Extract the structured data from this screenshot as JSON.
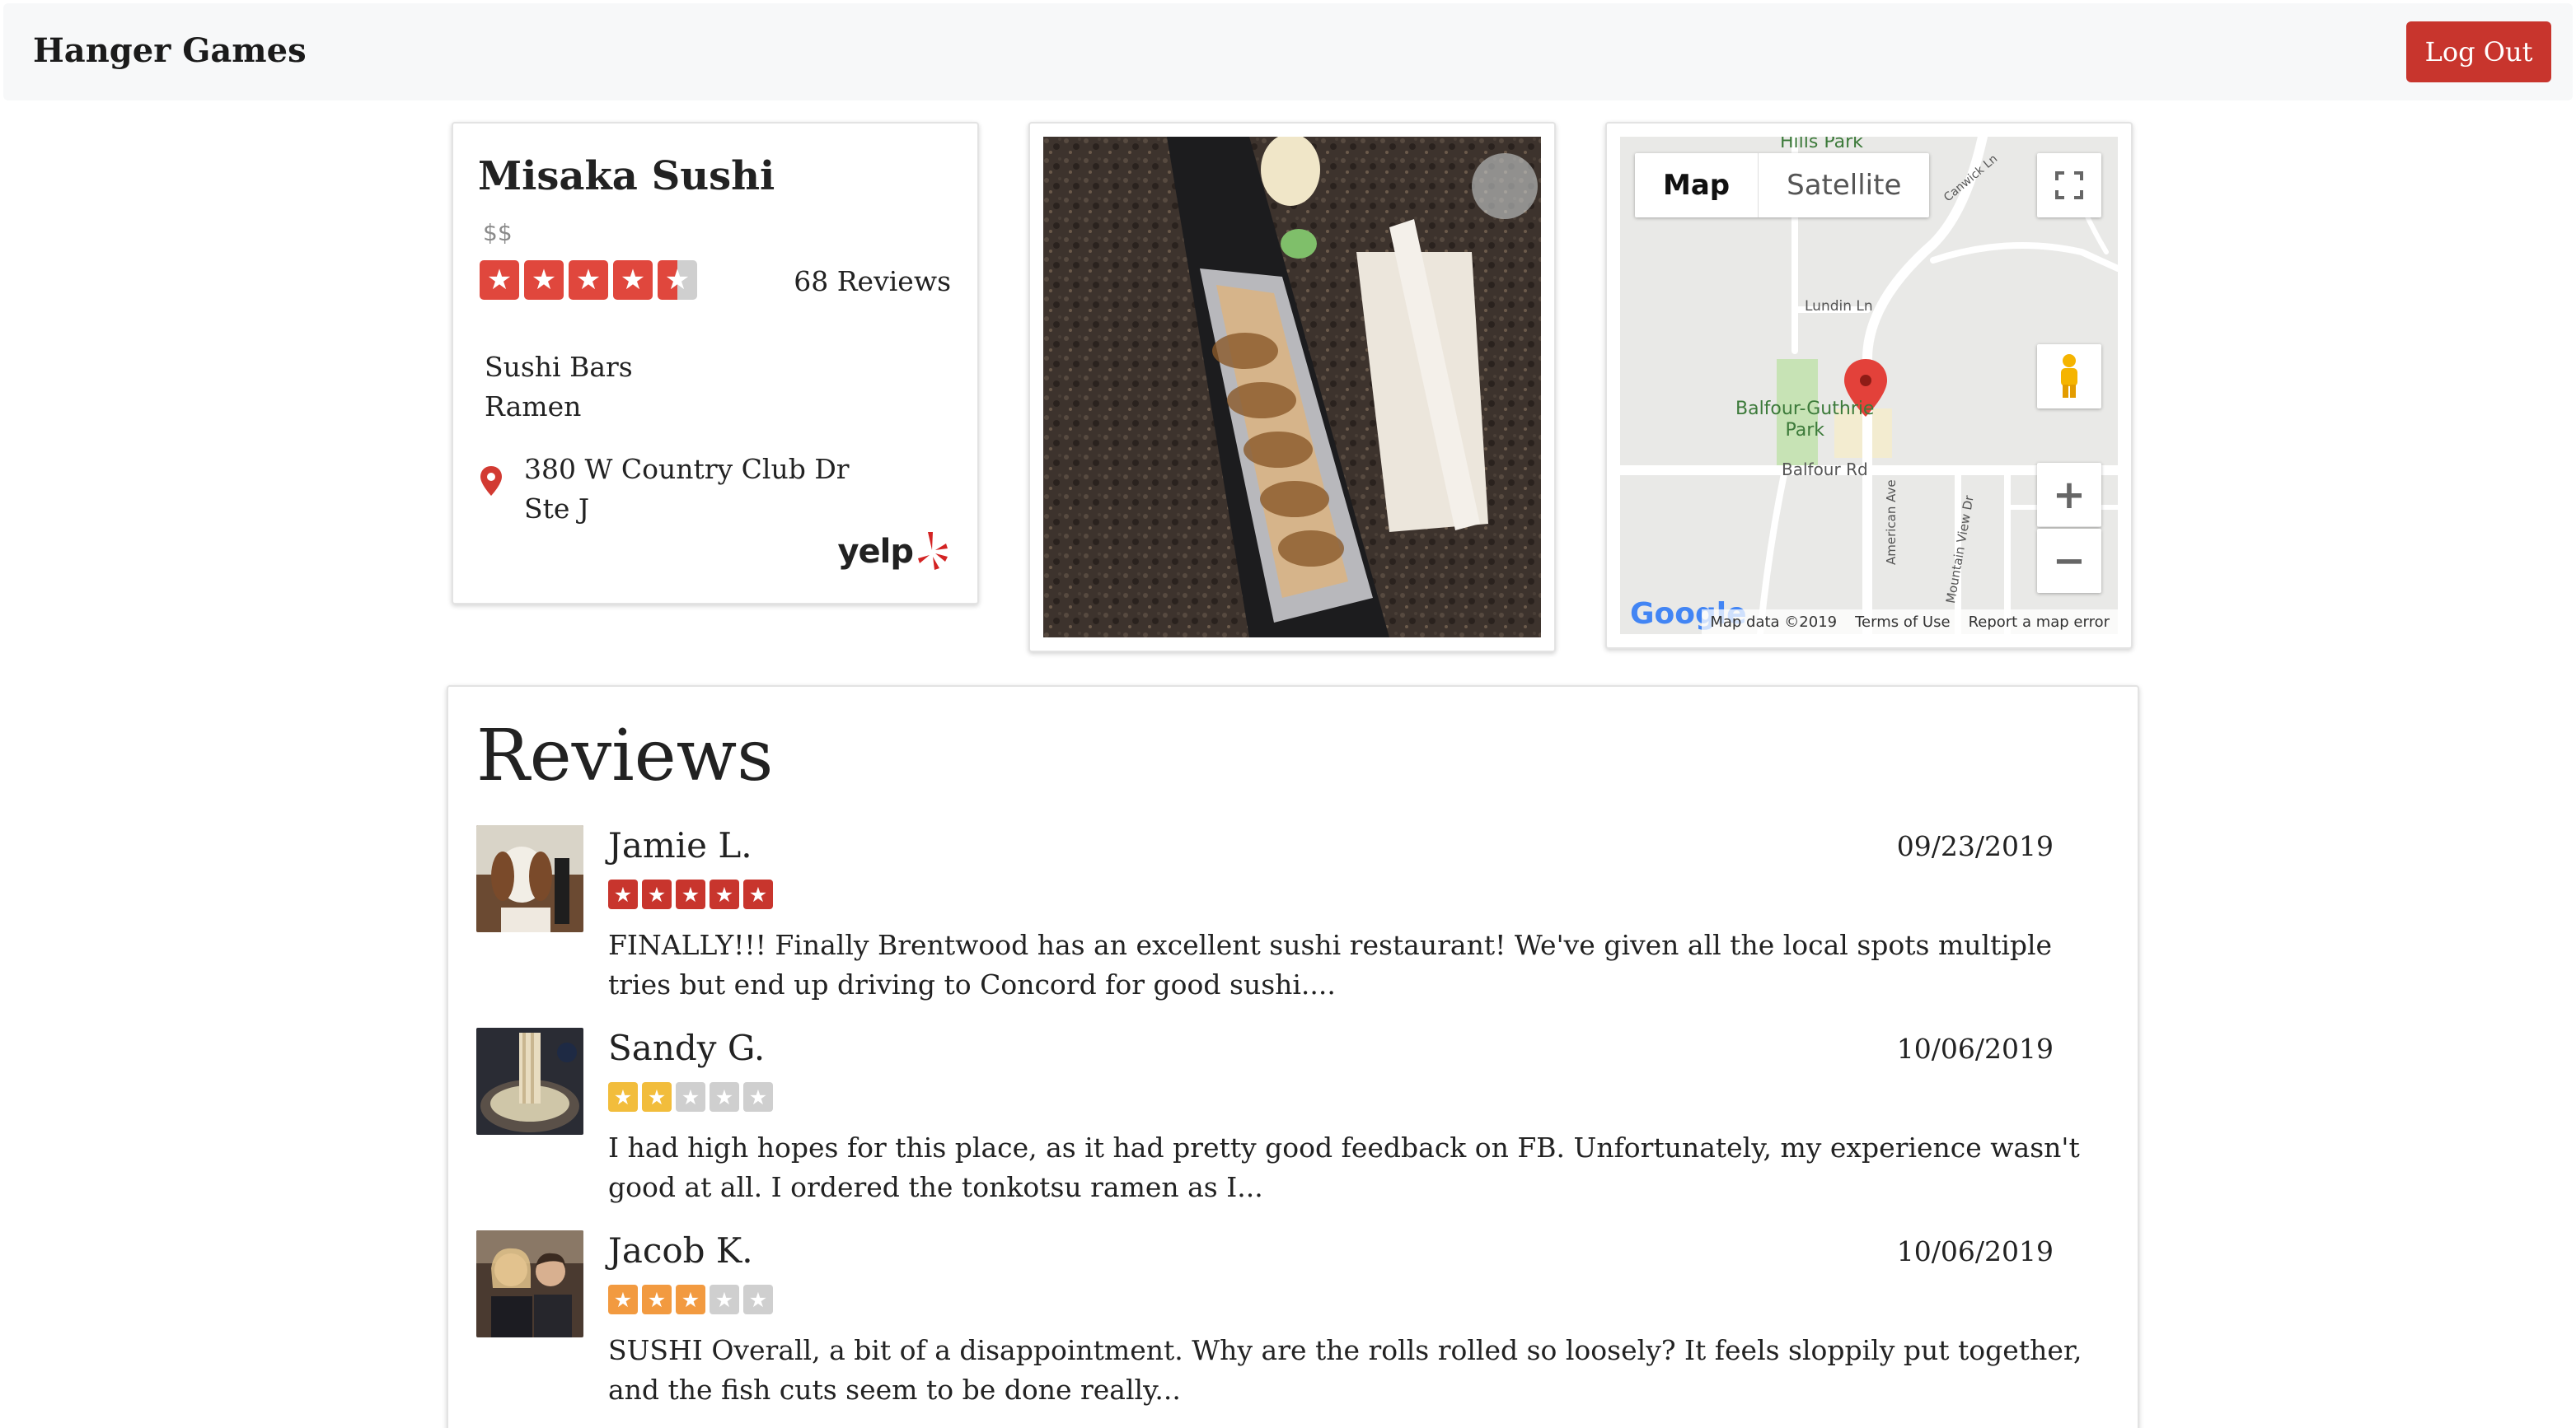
{
  "navbar": {
    "brand": "Hanger Games",
    "logout_label": "Log Out"
  },
  "restaurant": {
    "name": "Misaka Sushi",
    "price": "$$",
    "rating": 4.5,
    "review_count_text": "68 Reviews",
    "categories": [
      "Sushi Bars",
      "Ramen"
    ],
    "address_line1": "380 W Country Club Dr",
    "address_line2": "Ste J",
    "source_logo": "yelp"
  },
  "photo": {
    "subject": "sushi-roll-photo"
  },
  "map": {
    "tab_map": "Map",
    "tab_satellite": "Satellite",
    "labels": {
      "park": "Balfour-Guthrie\nPark",
      "road1": "Balfour Rd",
      "road2": "Lundin Ln",
      "road3": "Hills Park",
      "road4": "American Ave",
      "road5": "Mountain View Dr",
      "road6": "Canwick Ln"
    },
    "footer": {
      "data": "Map data ©2019",
      "terms": "Terms of Use",
      "report": "Report a map error"
    },
    "google_text": "Google",
    "zoom_in": "+",
    "zoom_out": "−"
  },
  "reviews_section": {
    "title": "Reviews",
    "items": [
      {
        "name": "Jamie L.",
        "date": "09/23/2019",
        "rating": 5,
        "star_color": "#c8352d",
        "text": "FINALLY!!! Finally Brentwood has an excellent sushi restaurant! We've given all the local spots multiple tries but end up driving to Concord for good sushi...."
      },
      {
        "name": "Sandy G.",
        "date": "10/06/2019",
        "rating": 2,
        "star_color": "#f2bd3c",
        "text": "I had high hopes for this place, as it had pretty good feedback on FB. Unfortunately, my experience wasn't good at all. I ordered the tonkotsu ramen as I..."
      },
      {
        "name": "Jacob K.",
        "date": "10/06/2019",
        "rating": 3,
        "star_color": "#f29a40",
        "text": "SUSHI Overall, a bit of a disappointment. Why are the rolls rolled so loosely? It feels sloppily put together, and the fish cuts seem to be done really..."
      }
    ]
  },
  "colors": {
    "accent_red": "#c8352d",
    "star_empty": "#cfcfcf",
    "navbar_bg": "#f7f8f9"
  }
}
